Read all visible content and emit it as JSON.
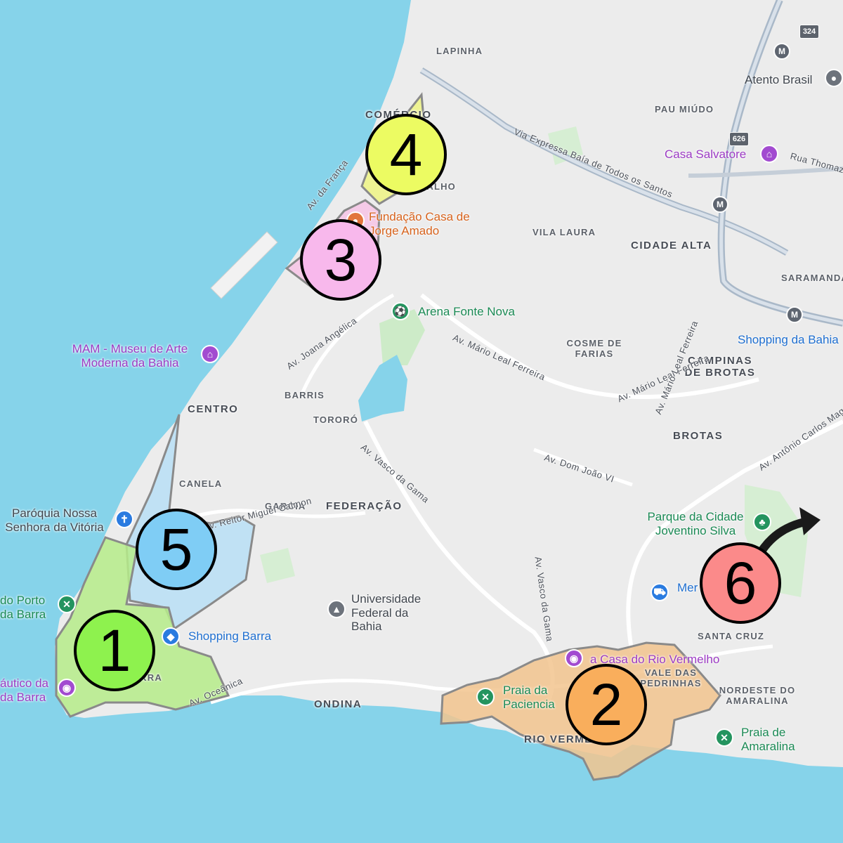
{
  "map": {
    "colors": {
      "water": "#86d3ea",
      "land": "#ececec",
      "park": "#cdebc8"
    },
    "neighborhoods": [
      "LAPINHA",
      "PAU MIÚDO",
      "COMÉRCIO",
      "BARBALHO",
      "VILA LAURA",
      "CIDADE ALTA",
      "SARAMANDAIA",
      "COSME DE FARIAS",
      "CAMPINAS DE BROTAS",
      "BARRIS",
      "CENTRO",
      "TORORÓ",
      "BROTAS",
      "CANELA",
      "GARCIA",
      "FEDERAÇÃO",
      "SANTA CRUZ",
      "VALE DAS PEDRINHAS",
      "NORDESTE DO AMARALINA",
      "ONDINA",
      "RIO VERMELHO",
      "BARRA"
    ],
    "roads": [
      "Via Expressa Baía de Todos os Santos",
      "Rua Thomaz",
      "Av. da França",
      "Av. Joana Angélica",
      "Av. Mário Leal Ferreira",
      "Av. Mário Leal Ferreira",
      "Av. Mário Leal Ferreira",
      "Av. Vasco da Gama",
      "Av. Dom João VI",
      "Av. Antônio Carlos Magalhães",
      "Av. Reitor Miguel Calmon",
      "Av. Vasco da Gama",
      "Av. Oceânica"
    ],
    "pois": {
      "atento": "Atento Brasil",
      "casa_salvatore": "Casa Salvatore",
      "fundacao": "Fundação Casa de Jorge Amado",
      "arena": "Arena Fonte Nova",
      "mam": "MAM - Museu de Arte Moderna da Bahia",
      "shopping_bahia": "Shopping da Bahia",
      "paroquia": "Paróquia Nossa Senhora da Vitória",
      "parque": "Parque da Cidade Joventino Silva",
      "forte_porto": "do Porto da Barra",
      "universidade": "Universidade Federal da Bahia",
      "mercado": "Mer Verme nha",
      "shopping_barra": "Shopping Barra",
      "nautico": "áutico da da Barra",
      "casa_rio_vermelho": "a Casa do Rio Vermelho",
      "praia_paciencia": "Praia da Paciencia",
      "praia_amaralina": "Praia de Amaralina"
    },
    "shields": {
      "r324": "324",
      "r626": "626"
    },
    "metro_symbol": "M"
  },
  "markers": [
    {
      "number": "1",
      "color": "#8ef24e",
      "area_color": "#b6ec8a"
    },
    {
      "number": "2",
      "color": "#f9ae5c",
      "area_color": "#f2c48e"
    },
    {
      "number": "3",
      "color": "#f8b8ec",
      "area_color": "#f7c4e6"
    },
    {
      "number": "4",
      "color": "#ecfb62",
      "area_color": "#eef48a"
    },
    {
      "number": "5",
      "color": "#7fcdf5",
      "area_color": "#b5dff6"
    },
    {
      "number": "6",
      "color": "#fb8a8a"
    }
  ],
  "arrow": {
    "icon": "curved-arrow-icon",
    "color": "#1a1a1a"
  }
}
